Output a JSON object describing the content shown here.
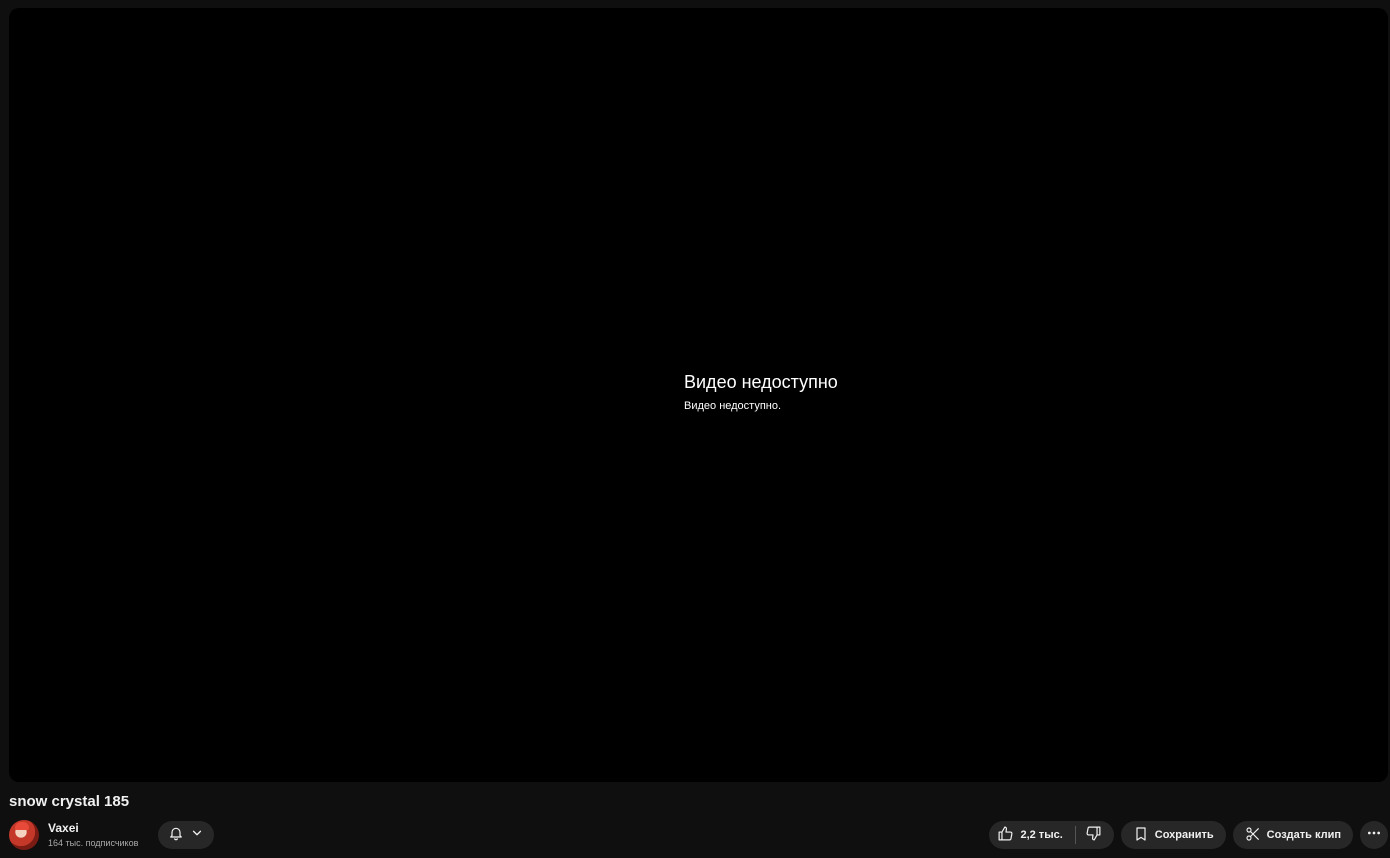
{
  "player": {
    "error_title": "Видео недоступно",
    "error_subtitle": "Видео недоступно."
  },
  "video": {
    "title": "snow crystal 185"
  },
  "channel": {
    "name": "Vaxei",
    "subscribers": "164 тыс. подписчиков"
  },
  "actions": {
    "like_count": "2,2 тыс.",
    "save_label": "Сохранить",
    "clip_label": "Создать клип"
  },
  "icons": {
    "bell": "bell-icon",
    "chevron": "chevron-down-icon",
    "like": "thumbs-up-icon",
    "dislike": "thumbs-down-icon",
    "save": "bookmark-icon",
    "clip": "scissors-icon",
    "more": "more-horizontal-icon"
  },
  "colors": {
    "background": "#0f0f0f",
    "player": "#000000",
    "button": "#272727",
    "text": "#f1f1f1",
    "muted": "#aaaaaa"
  }
}
